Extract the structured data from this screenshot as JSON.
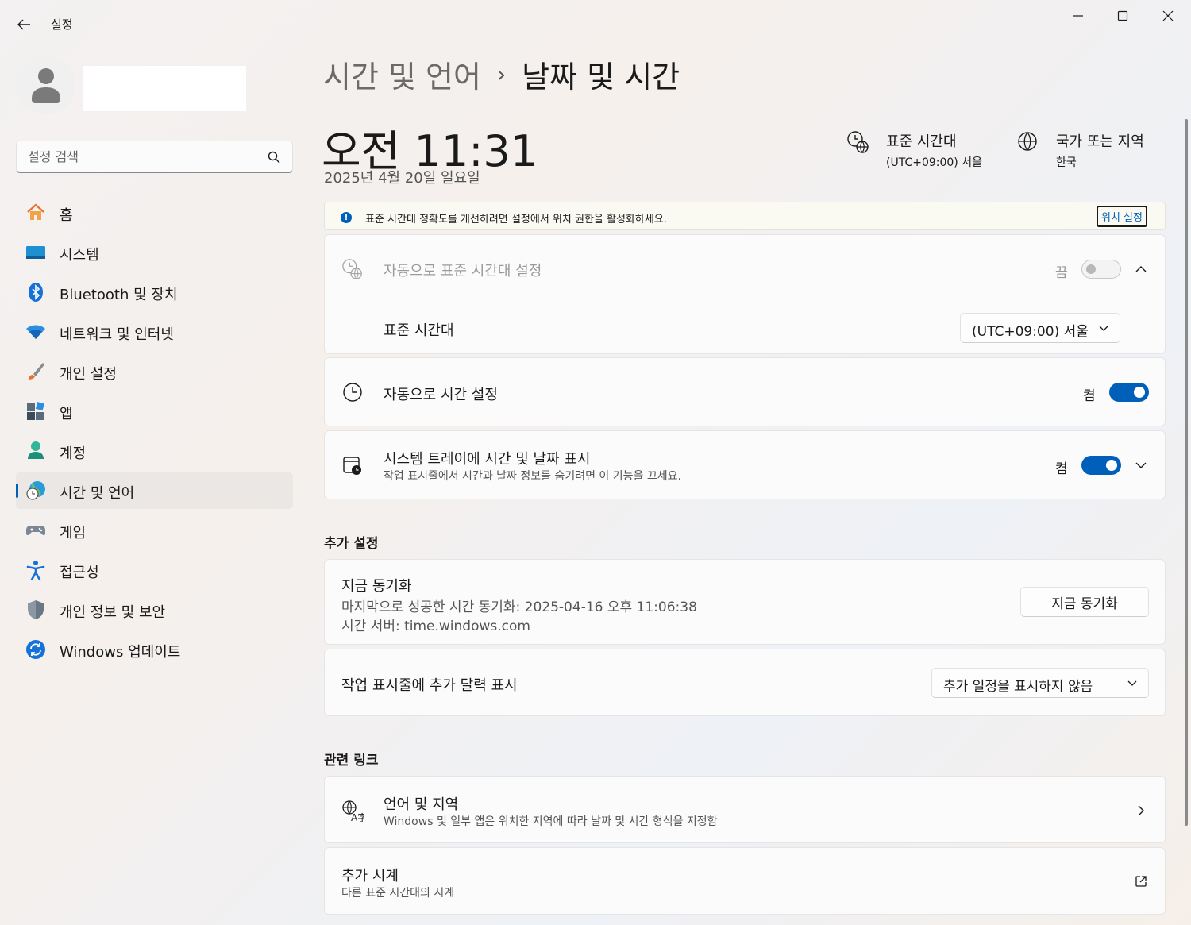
{
  "window": {
    "title": "설정",
    "back_icon": "arrow-left-icon",
    "minimize_icon": "minimize-icon",
    "maximize_icon": "maximize-icon",
    "close_icon": "close-icon"
  },
  "profile": {
    "avatar_icon": "person-icon"
  },
  "search": {
    "placeholder": "설정 검색",
    "icon": "search-icon"
  },
  "sidebar": {
    "items": [
      {
        "label": "홈",
        "icon": "home-icon",
        "active": false
      },
      {
        "label": "시스템",
        "icon": "system-icon",
        "active": false
      },
      {
        "label": "Bluetooth 및 장치",
        "icon": "bluetooth-icon",
        "active": false
      },
      {
        "label": "네트워크 및 인터넷",
        "icon": "wifi-icon",
        "active": false
      },
      {
        "label": "개인 설정",
        "icon": "brush-icon",
        "active": false
      },
      {
        "label": "앱",
        "icon": "apps-icon",
        "active": false
      },
      {
        "label": "계정",
        "icon": "account-icon",
        "active": false
      },
      {
        "label": "시간 및 언어",
        "icon": "time-language-icon",
        "active": true
      },
      {
        "label": "게임",
        "icon": "gamepad-icon",
        "active": false
      },
      {
        "label": "접근성",
        "icon": "accessibility-icon",
        "active": false
      },
      {
        "label": "개인 정보 및 보안",
        "icon": "shield-icon",
        "active": false
      },
      {
        "label": "Windows 업데이트",
        "icon": "update-icon",
        "active": false
      }
    ]
  },
  "breadcrumb": {
    "parent": "시간 및 언어",
    "separator": "›",
    "current": "날짜 및 시간"
  },
  "clock": {
    "time": "오전 11:31",
    "date": "2025년 4월 20일 일요일"
  },
  "header_info": {
    "timezone_title": "표준 시간대",
    "timezone_value": "(UTC+09:00) 서울",
    "region_title": "국가 또는 지역",
    "region_value": "한국"
  },
  "banner": {
    "text": "표준 시간대 정확도를 개선하려면 설정에서 위치 권한을 활성화하세요.",
    "link": "위치 설정",
    "icon": "info-icon"
  },
  "auto_timezone": {
    "title": "자동으로 표준 시간대 설정",
    "toggle_label": "끔",
    "enabled": false,
    "expanded": true,
    "sub_title": "표준 시간대",
    "dropdown_value": "(UTC+09:00) 서울"
  },
  "auto_time": {
    "title": "자동으로 시간 설정",
    "toggle_label": "켬",
    "enabled": true
  },
  "tray_time": {
    "title": "시스템 트레이에 시간 및 날짜 표시",
    "subtitle": "작업 표시줄에서 시간과 날짜 정보를 숨기려면 이 기능을 끄세요.",
    "toggle_label": "켬",
    "enabled": true
  },
  "additional": {
    "section_title": "추가 설정",
    "sync_title": "지금 동기화",
    "sync_last": "마지막으로 성공한 시간 동기화: 2025-04-16 오후 11:06:38",
    "sync_server": "시간 서버: time.windows.com",
    "sync_button": "지금 동기화",
    "calendar_title": "작업 표시줄에 추가 달력 표시",
    "calendar_value": "추가 일정을 표시하지 않음"
  },
  "related": {
    "section_title": "관련 링크",
    "lang_title": "언어 및 지역",
    "lang_sub": "Windows 및 일부 앱은 위치한 지역에 따라 날짜 및 시간 형식을 지정함",
    "clock_title": "추가 시계",
    "clock_sub": "다른 표준 시간대의 시계"
  },
  "colors": {
    "accent": "#005fb8"
  }
}
